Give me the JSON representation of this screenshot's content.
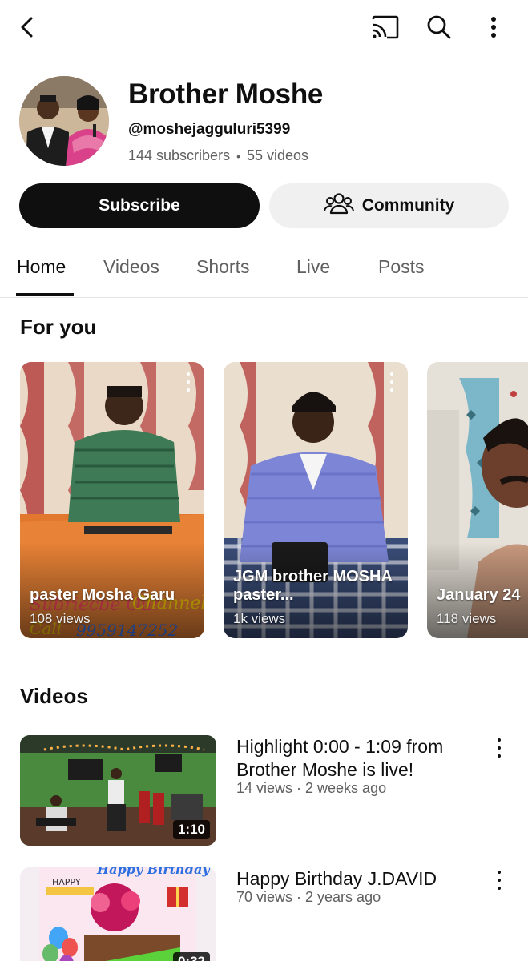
{
  "icons": {
    "back": "back-arrow-icon",
    "cast": "cast-icon",
    "search": "search-icon",
    "more": "more-vertical-icon",
    "community": "community-people-icon"
  },
  "channel": {
    "name": "Brother Moshe",
    "handle": "@moshejagguluri5399",
    "subscribers": "144 subscribers",
    "separator": "•",
    "videos_count": "55 videos"
  },
  "actions": {
    "subscribe_label": "Subscribe",
    "community_label": "Community"
  },
  "tabs": [
    {
      "label": "Home",
      "active": true
    },
    {
      "label": "Videos",
      "active": false
    },
    {
      "label": "Shorts",
      "active": false
    },
    {
      "label": "Live",
      "active": false
    },
    {
      "label": "Posts",
      "active": false
    }
  ],
  "for_you": {
    "title": "For you",
    "shorts": [
      {
        "title": "paster Mosha Garu",
        "views": "108 views"
      },
      {
        "title": "JGM brother MOSHA paster...",
        "views": "1k views"
      },
      {
        "title": "January 24",
        "views": "118 views"
      }
    ]
  },
  "videos_section": {
    "title": "Videos",
    "items": [
      {
        "title": "Highlight 0:00 - 1:09 from Brother Moshe  is live!",
        "meta": "14 views · 2 weeks ago",
        "duration": "1:10"
      },
      {
        "title": "Happy Birthday J.DAVID",
        "meta": "70 views · 2 years ago",
        "duration": "0:32"
      }
    ]
  },
  "colors": {
    "text_primary": "#0f0f0f",
    "text_secondary": "#606060",
    "subscribe_bg": "#0f0f0f",
    "community_bg": "#f0f0f0"
  }
}
